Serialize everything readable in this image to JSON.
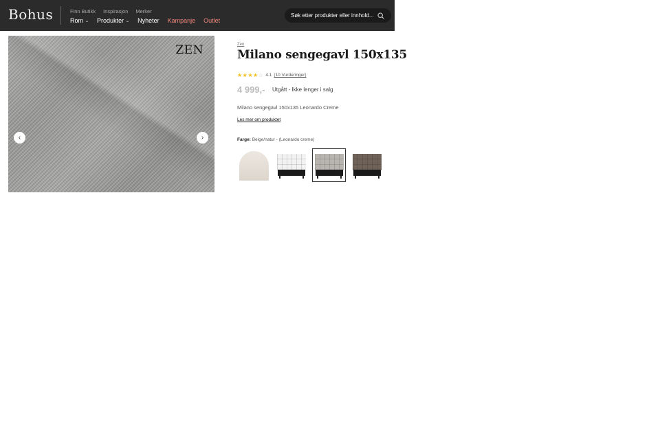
{
  "header": {
    "logo": "Bohus",
    "top_links": [
      "Finn Butikk",
      "Inspirasjon",
      "Merker"
    ],
    "nav": [
      {
        "label": "Rom",
        "dropdown": true,
        "accent": false
      },
      {
        "label": "Produkter",
        "dropdown": true,
        "accent": false
      },
      {
        "label": "Nyheter",
        "dropdown": false,
        "accent": false
      },
      {
        "label": "Kampanje",
        "dropdown": false,
        "accent": true
      },
      {
        "label": "Outlet",
        "dropdown": false,
        "accent": true
      }
    ],
    "search_placeholder": "Søk etter produkter eller innhold...",
    "accent_color": "#f3877a",
    "background_color": "#2b2b2c"
  },
  "gallery": {
    "watermark": "ZEN",
    "icons": {
      "prev": "chevron-left-icon",
      "next": "chevron-right-icon"
    }
  },
  "product": {
    "brand": "Zen",
    "title": "Milano sengegavl 150x135",
    "rating": {
      "value": 4.1,
      "stars_filled": 4,
      "stars_total": 5,
      "score_text": "4.1",
      "reviews_text": "(10 Vurderinger)"
    },
    "price": "4 999,-",
    "status": "Utgått - Ikke lenger i salg",
    "description": "Milano sengegavl 150x135 Leonardo Creme",
    "read_more": "Les mer om produktet",
    "color_label": "Farge:",
    "color_value": "Beige/natur - (Leonardo creme)",
    "swatches": [
      {
        "name": "arched-headboard-beige",
        "selected": false,
        "color": "#e6e0d8"
      },
      {
        "name": "headboard-white",
        "selected": false,
        "color": "#f2f2f2"
      },
      {
        "name": "headboard-grey",
        "selected": true,
        "color": "#b5b3ae"
      },
      {
        "name": "headboard-brown",
        "selected": false,
        "color": "#6b5f55"
      }
    ]
  }
}
